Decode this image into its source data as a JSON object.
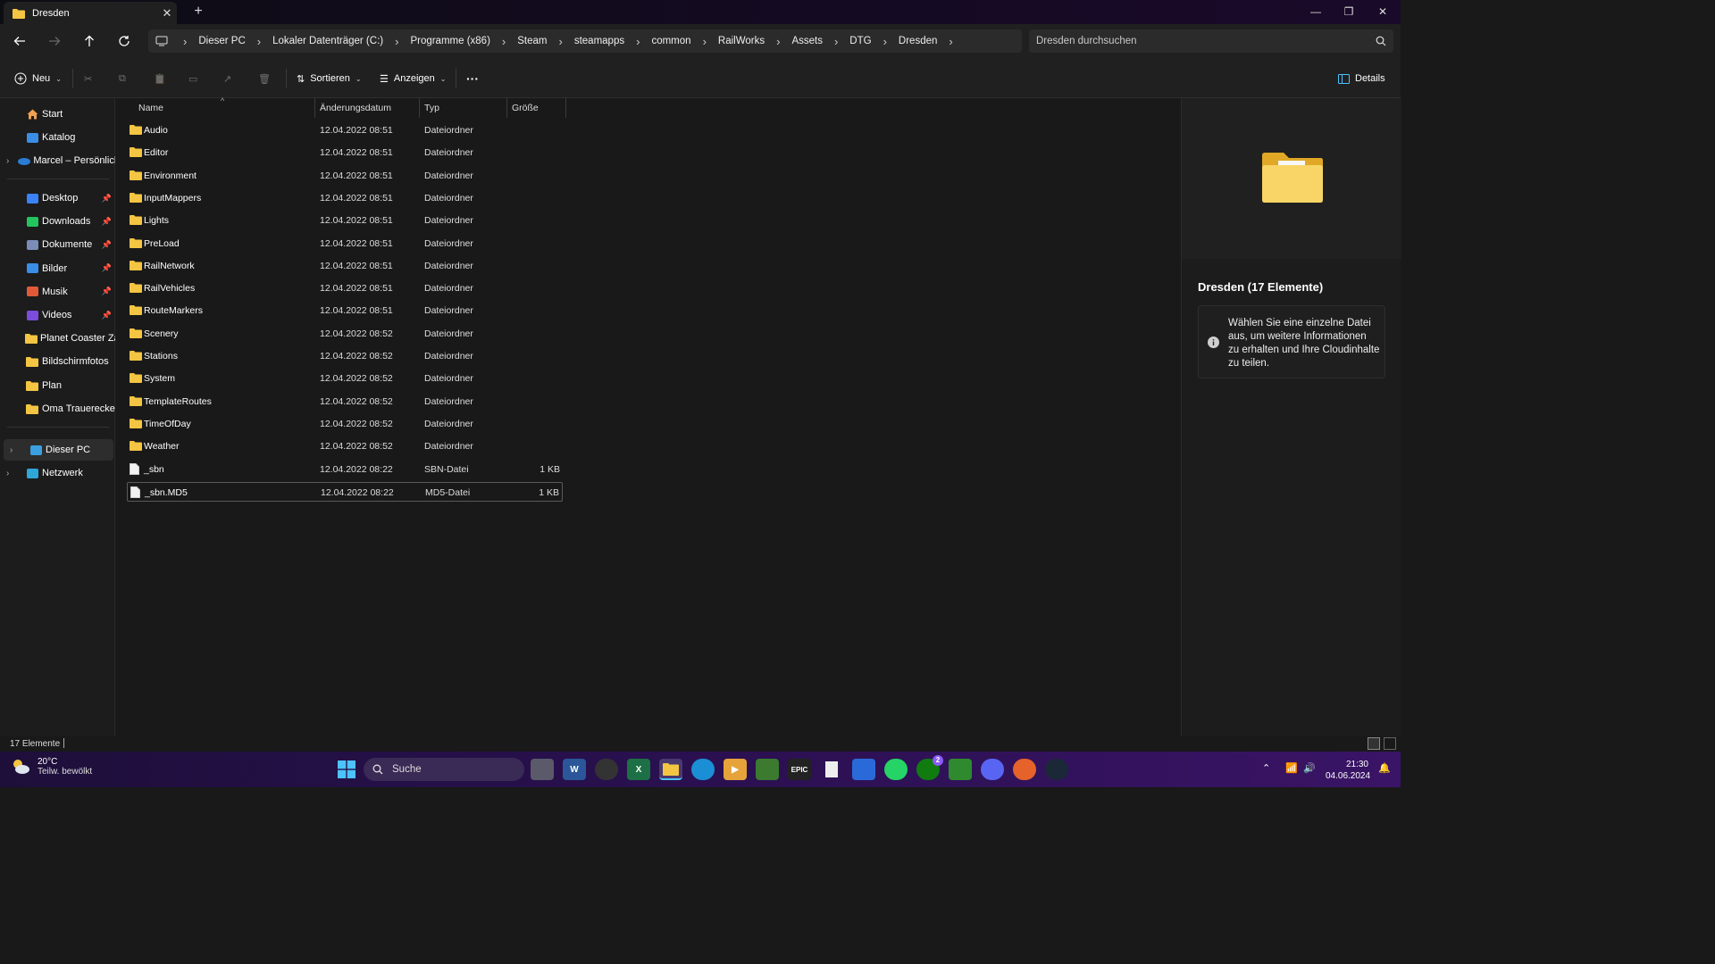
{
  "window": {
    "tab_title": "Dresden",
    "close_tab": "✕",
    "new_tab": "+"
  },
  "nav": {
    "breadcrumb": [
      "Dieser PC",
      "Lokaler Datenträger (C:)",
      "Programme (x86)",
      "Steam",
      "steamapps",
      "common",
      "RailWorks",
      "Assets",
      "DTG",
      "Dresden"
    ],
    "search_placeholder": "Dresden durchsuchen"
  },
  "toolbar": {
    "new_label": "Neu",
    "sort_label": "Sortieren",
    "view_label": "Anzeigen",
    "more_label": "···",
    "details_label": "Details"
  },
  "sidebar": {
    "top": [
      {
        "label": "Start",
        "icon": "home-icon"
      },
      {
        "label": "Katalog",
        "icon": "gallery-icon"
      },
      {
        "label": "Marcel – Persönlich",
        "icon": "onedrive-icon",
        "chevron": true
      }
    ],
    "pinned": [
      {
        "label": "Desktop",
        "icon": "desktop-icon",
        "color": "#3b82f6"
      },
      {
        "label": "Downloads",
        "icon": "download-icon",
        "color": "#22c55e"
      },
      {
        "label": "Dokumente",
        "icon": "document-icon",
        "color": "#7b8cb8"
      },
      {
        "label": "Bilder",
        "icon": "picture-icon",
        "color": "#3a8ee6"
      },
      {
        "label": "Musik",
        "icon": "music-icon",
        "color": "#e05a3a"
      },
      {
        "label": "Videos",
        "icon": "video-icon",
        "color": "#7c4ddb"
      }
    ],
    "folders": [
      {
        "label": "Planet Coaster Zaul"
      },
      {
        "label": "Bildschirmfotos"
      },
      {
        "label": "Plan"
      },
      {
        "label": "Oma  Trauerecke"
      }
    ],
    "bottom": [
      {
        "label": "Dieser PC",
        "icon": "pc-icon"
      },
      {
        "label": "Netzwerk",
        "icon": "network-icon"
      }
    ]
  },
  "columns": {
    "name": "Name",
    "date": "Änderungsdatum",
    "type": "Typ",
    "size": "Größe"
  },
  "files": [
    {
      "name": "Audio",
      "date": "12.04.2022 08:51",
      "type": "Dateiordner",
      "size": "",
      "kind": "folder"
    },
    {
      "name": "Editor",
      "date": "12.04.2022 08:51",
      "type": "Dateiordner",
      "size": "",
      "kind": "folder"
    },
    {
      "name": "Environment",
      "date": "12.04.2022 08:51",
      "type": "Dateiordner",
      "size": "",
      "kind": "folder"
    },
    {
      "name": "InputMappers",
      "date": "12.04.2022 08:51",
      "type": "Dateiordner",
      "size": "",
      "kind": "folder"
    },
    {
      "name": "Lights",
      "date": "12.04.2022 08:51",
      "type": "Dateiordner",
      "size": "",
      "kind": "folder"
    },
    {
      "name": "PreLoad",
      "date": "12.04.2022 08:51",
      "type": "Dateiordner",
      "size": "",
      "kind": "folder"
    },
    {
      "name": "RailNetwork",
      "date": "12.04.2022 08:51",
      "type": "Dateiordner",
      "size": "",
      "kind": "folder"
    },
    {
      "name": "RailVehicles",
      "date": "12.04.2022 08:51",
      "type": "Dateiordner",
      "size": "",
      "kind": "folder"
    },
    {
      "name": "RouteMarkers",
      "date": "12.04.2022 08:51",
      "type": "Dateiordner",
      "size": "",
      "kind": "folder"
    },
    {
      "name": "Scenery",
      "date": "12.04.2022 08:52",
      "type": "Dateiordner",
      "size": "",
      "kind": "folder"
    },
    {
      "name": "Stations",
      "date": "12.04.2022 08:52",
      "type": "Dateiordner",
      "size": "",
      "kind": "folder"
    },
    {
      "name": "System",
      "date": "12.04.2022 08:52",
      "type": "Dateiordner",
      "size": "",
      "kind": "folder"
    },
    {
      "name": "TemplateRoutes",
      "date": "12.04.2022 08:52",
      "type": "Dateiordner",
      "size": "",
      "kind": "folder"
    },
    {
      "name": "TimeOfDay",
      "date": "12.04.2022 08:52",
      "type": "Dateiordner",
      "size": "",
      "kind": "folder"
    },
    {
      "name": "Weather",
      "date": "12.04.2022 08:52",
      "type": "Dateiordner",
      "size": "",
      "kind": "folder"
    },
    {
      "name": "_sbn",
      "date": "12.04.2022 08:22",
      "type": "SBN-Datei",
      "size": "1 KB",
      "kind": "file"
    },
    {
      "name": "_sbn.MD5",
      "date": "12.04.2022 08:22",
      "type": "MD5-Datei",
      "size": "1 KB",
      "kind": "file",
      "selected": true
    }
  ],
  "details": {
    "title": "Dresden (17 Elemente)",
    "info": "Wählen Sie eine einzelne Datei aus, um weitere Informationen zu erhalten und Ihre Cloudinhalte zu teilen."
  },
  "status": {
    "count": "17 Elemente"
  },
  "taskbar": {
    "temp": "20°C",
    "weather": "Teilw. bewölkt",
    "search_label": "Suche",
    "xbox_badge": "2",
    "time": "21:30",
    "date": "04.06.2024"
  },
  "colors": {
    "folder": "#f4c542",
    "accent": "#4cc2ff"
  }
}
